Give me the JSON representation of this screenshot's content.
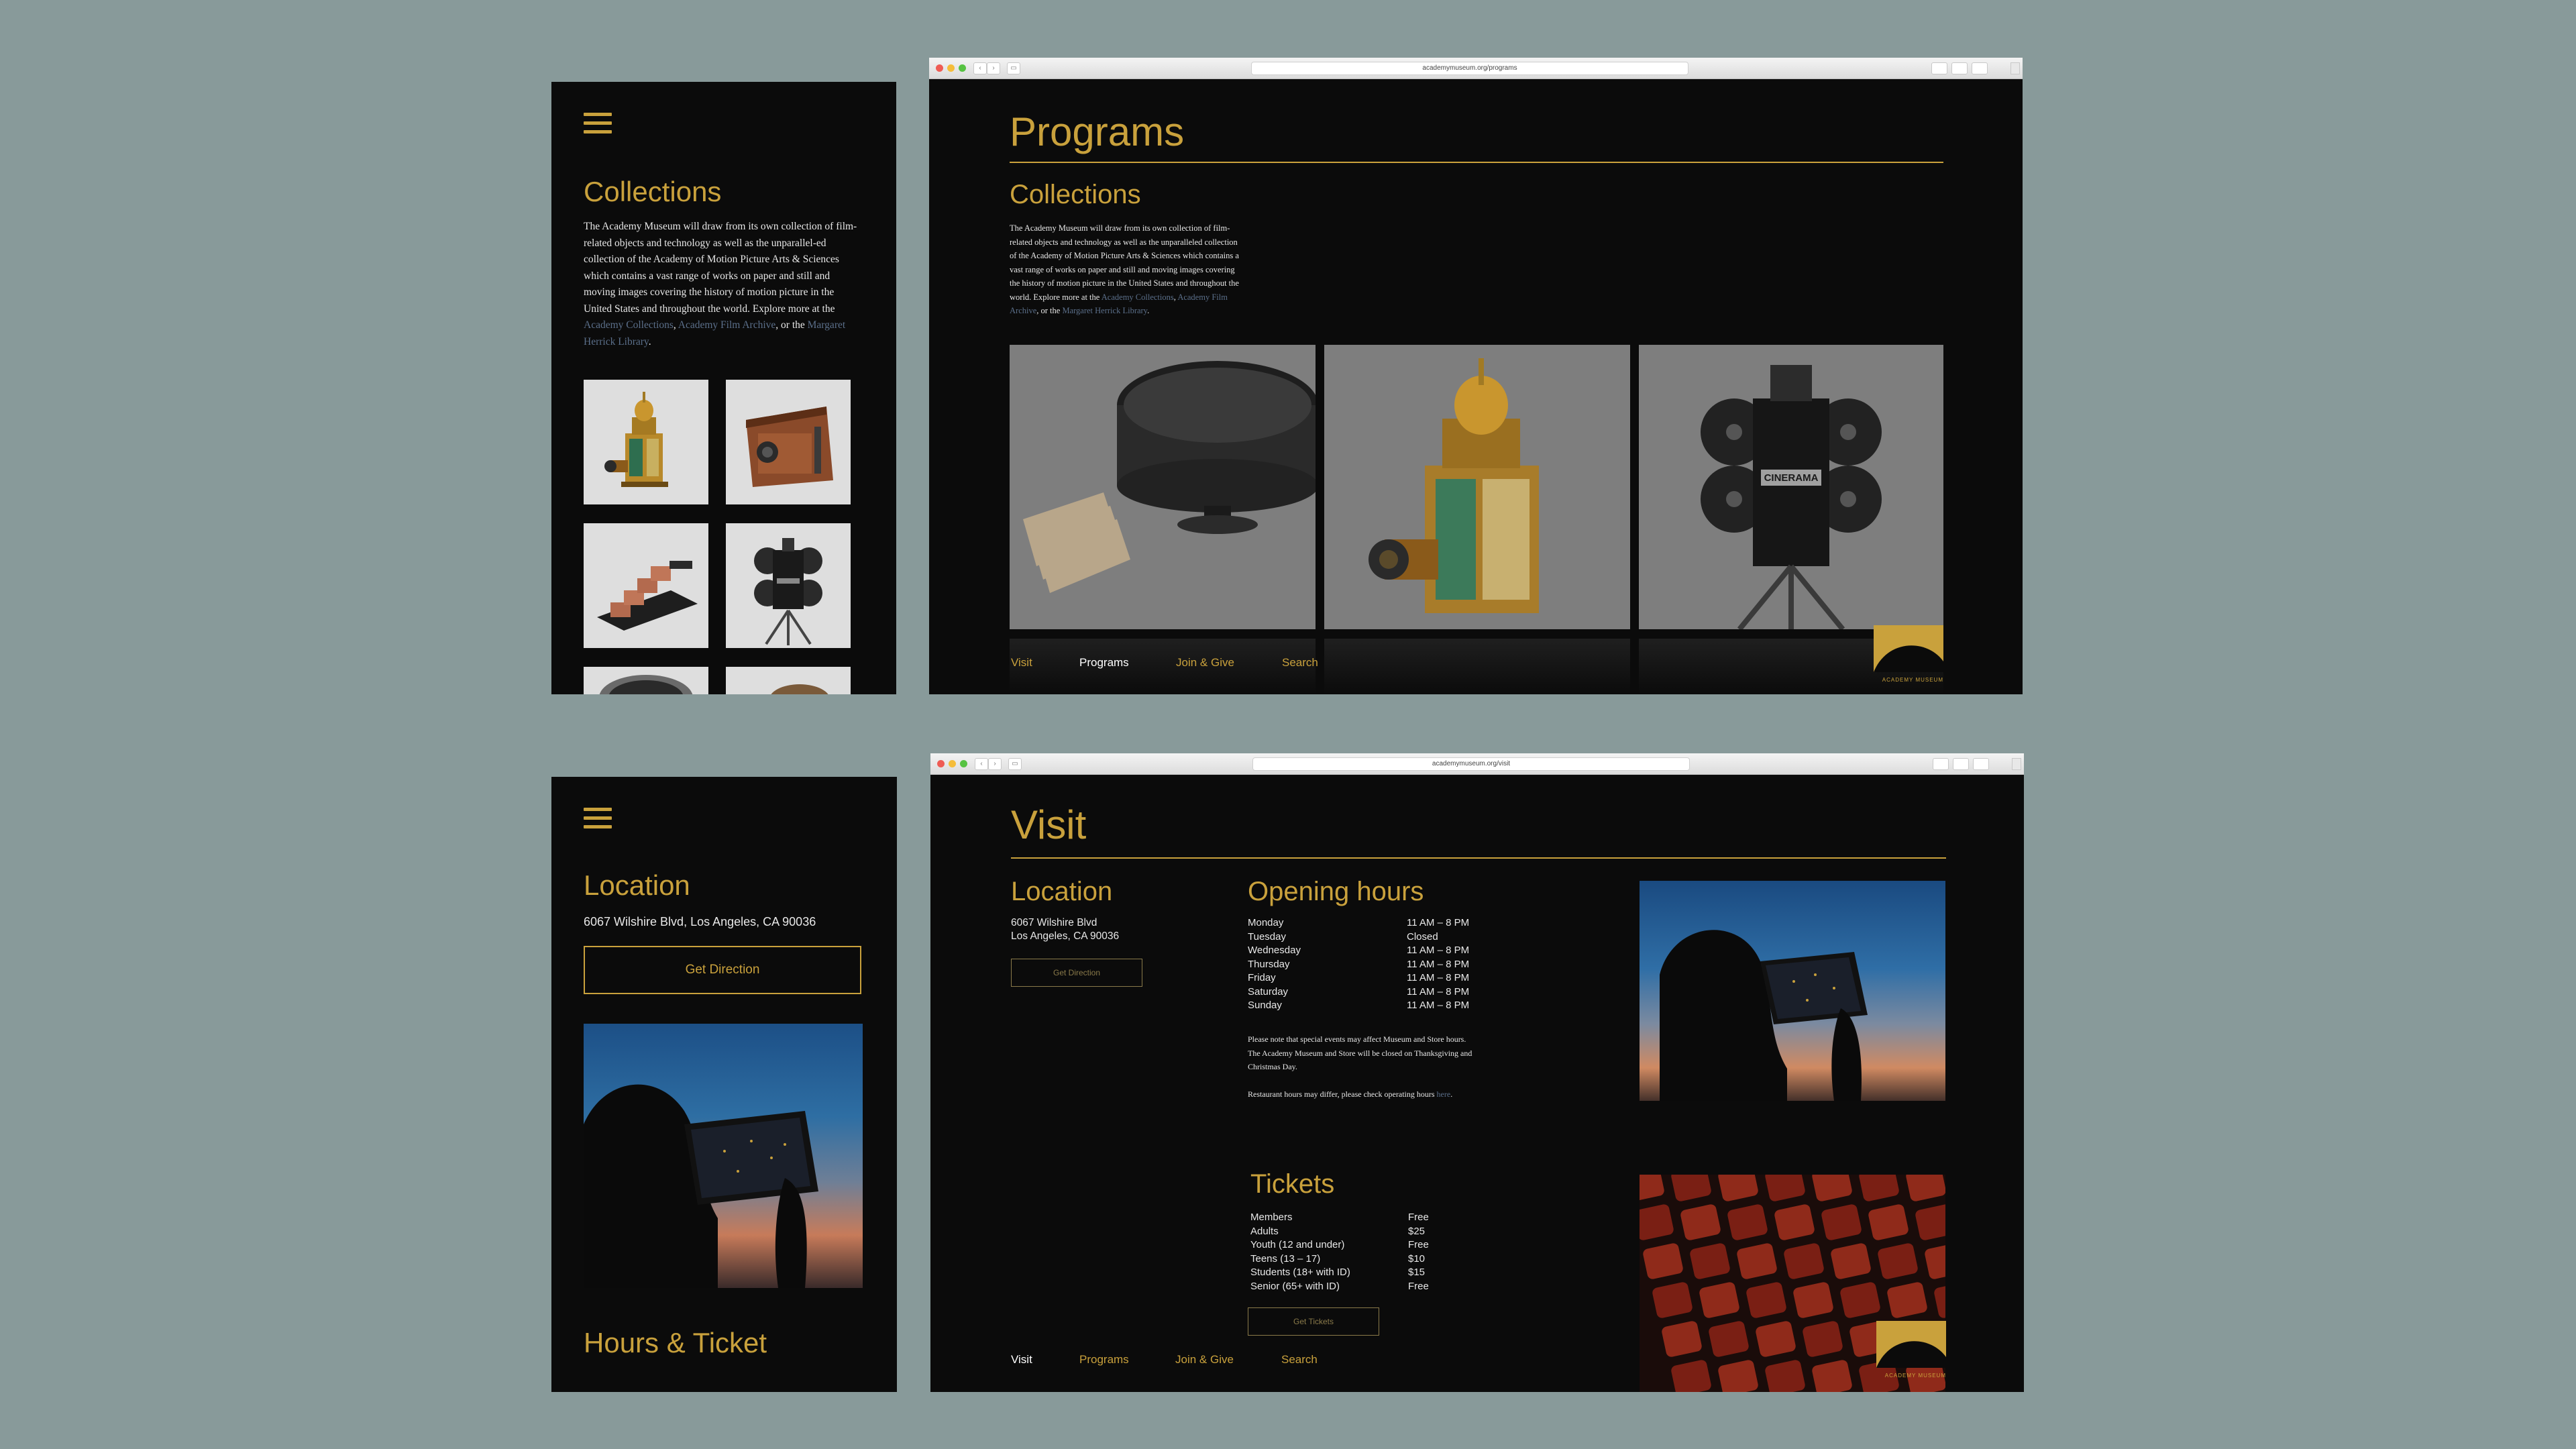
{
  "mobile_collections": {
    "title": "Collections",
    "body_before": "The Academy Museum will draw from its own collection of film-related objects and technology as well as the unparallel-ed collection of the Academy of Motion Picture Arts & Sciences which contains a vast range of works on paper and still and moving images covering the history of motion picture in the United States and throughout the world. Explore more at the ",
    "link1": "Academy Collections",
    "sep1": ", ",
    "link2": "Academy Film Archive",
    "sep2": ", or the ",
    "link3": "Margaret Herrick Library",
    "end": "."
  },
  "desktop_programs": {
    "url": "academymuseum.org/programs",
    "page_title": "Programs",
    "section_title": "Collections",
    "body_before": "The Academy Museum will draw from its own collection of film-related objects and technology as well as the unparalleled collection of the Academy of Motion Picture Arts & Sciences which contains a vast range of works on paper and still and moving images covering the history of motion picture in the United States and throughout the world. Explore more at the ",
    "link1": "Academy Collections",
    "sep1": ", ",
    "link2": "Academy Film Archive",
    "sep2": ", or the ",
    "link3": "Margaret Herrick Library",
    "end": ".",
    "nav": [
      "Visit",
      "Programs",
      "Join & Give",
      "Search"
    ],
    "active_nav": "Programs",
    "camera_label": "CINERAMA",
    "logo_text": "ACADEMY MUSEUM"
  },
  "mobile_visit": {
    "location_title": "Location",
    "address": "6067 Wilshire Blvd, Los Angeles, CA 90036",
    "direction_button": "Get Direction",
    "hours_title": "Hours & Ticket"
  },
  "desktop_visit": {
    "url": "academymuseum.org/visit",
    "page_title": "Visit",
    "location_title": "Location",
    "address_line1": "6067 Wilshire Blvd",
    "address_line2": "Los Angeles, CA 90036",
    "direction_button": "Get Direction",
    "hours_title": "Opening hours",
    "hours": [
      {
        "day": "Monday",
        "time": "11 AM – 8 PM"
      },
      {
        "day": "Tuesday",
        "time": "Closed"
      },
      {
        "day": "Wednesday",
        "time": "11 AM – 8 PM"
      },
      {
        "day": "Thursday",
        "time": "11 AM – 8 PM"
      },
      {
        "day": "Friday",
        "time": "11 AM – 8 PM"
      },
      {
        "day": "Saturday",
        "time": "11 AM – 8 PM"
      },
      {
        "day": "Sunday",
        "time": "11 AM – 8 PM"
      }
    ],
    "note1": "Please note that special events may affect Museum and Store hours. The Academy Museum and Store will be closed on Thanksgiving and Christmas Day.",
    "note2_before": "Restaurant hours may differ, please check operating hours ",
    "note2_link": "here",
    "note2_end": ".",
    "tickets_title": "Tickets",
    "tickets": [
      {
        "label": "Members",
        "price": "Free"
      },
      {
        "label": "Adults",
        "price": "$25"
      },
      {
        "label": "Youth (12 and under)",
        "price": "Free"
      },
      {
        "label": "Teens (13 – 17)",
        "price": "$10"
      },
      {
        "label": "Students (18+ with ID)",
        "price": "$15"
      },
      {
        "label": "Senior (65+ with ID)",
        "price": "Free"
      }
    ],
    "tickets_button": "Get Tickets",
    "nav": [
      "Visit",
      "Programs",
      "Join & Give",
      "Search"
    ],
    "active_nav": "Visit",
    "logo_text": "ACADEMY MUSEUM"
  },
  "colors": {
    "background": "#889a9a",
    "panel": "#0b0b0b",
    "gold": "#c9a13c",
    "link": "#5b6f8a"
  }
}
